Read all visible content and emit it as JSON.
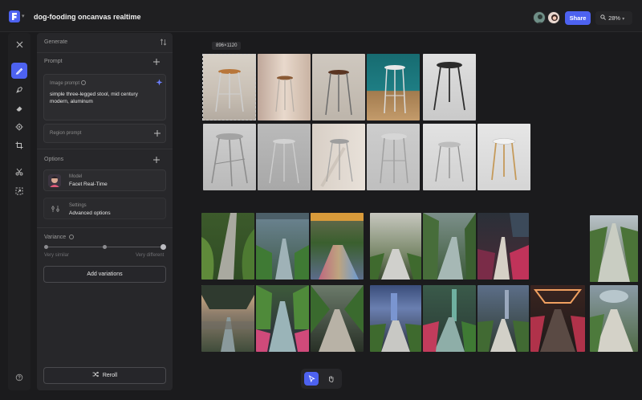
{
  "header": {
    "title": "dog-fooding oncanvas realtime",
    "share_label": "Share",
    "zoom_label": "28%"
  },
  "toolbar": {
    "tools": [
      "close-icon",
      "brush-icon",
      "pen-icon",
      "eraser-icon",
      "target-icon",
      "crop-icon",
      "scissors-icon",
      "expand-icon",
      "help-icon"
    ]
  },
  "panel": {
    "title": "Generate",
    "prompt_section": "Prompt",
    "image_prompt_label": "Image prompt",
    "image_prompt_text": "simple three-legged stool, mid century modern, aluminum",
    "region_prompt_label": "Region prompt",
    "options_section": "Options",
    "model_label": "Model",
    "model_value": "Facet Real-Time",
    "settings_label": "Settings",
    "settings_value": "Advanced options",
    "variance_label": "Variance",
    "variance_min": "Very similar",
    "variance_max": "Very different",
    "variance_level": 1.0,
    "add_variations_label": "Add variations",
    "reroll_label": "Reroll"
  },
  "canvas": {
    "selected_size": "896×1120"
  },
  "colors": {
    "accent": "#4d62f0",
    "background": "#1b1b1d",
    "panel": "#27272a"
  }
}
